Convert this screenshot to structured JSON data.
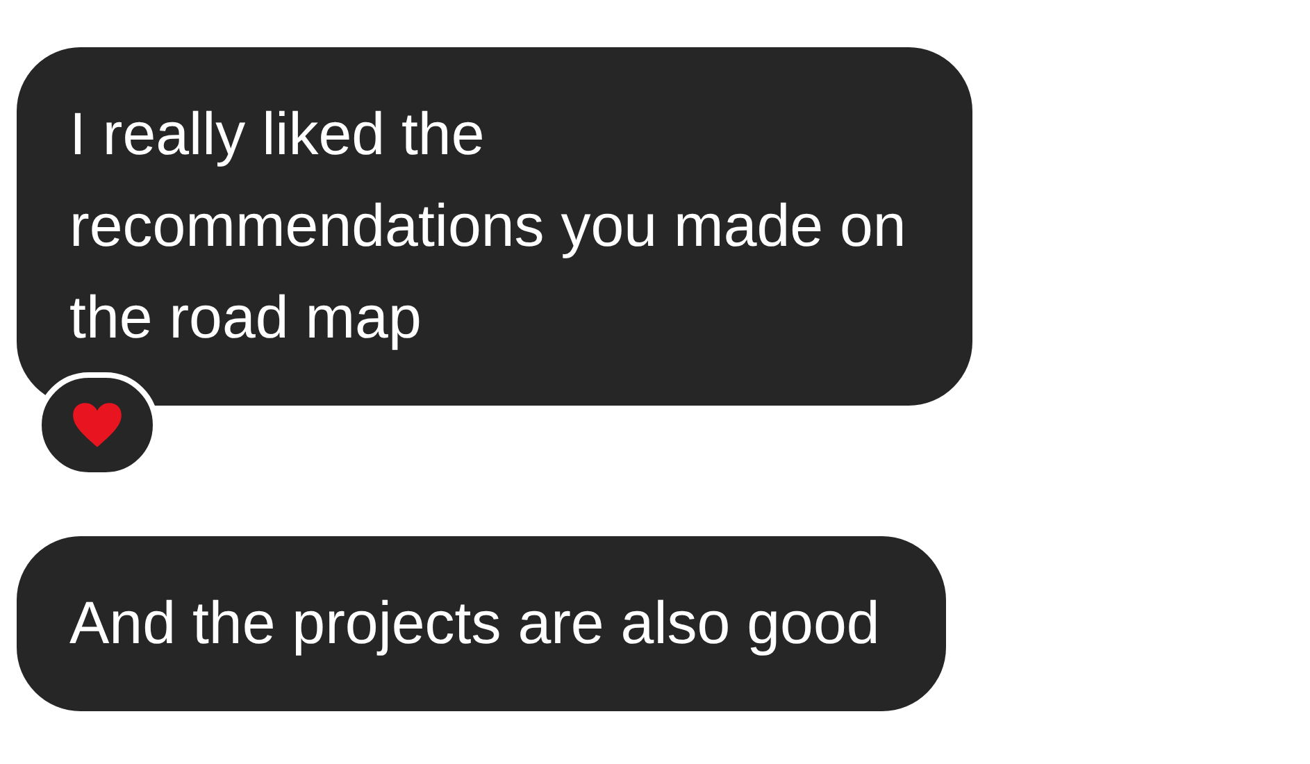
{
  "messages": [
    {
      "text": "I really liked the\nrecommendations you made on\nthe road map",
      "reaction": true
    },
    {
      "text": "And the projects are also good",
      "reaction": false
    }
  ]
}
